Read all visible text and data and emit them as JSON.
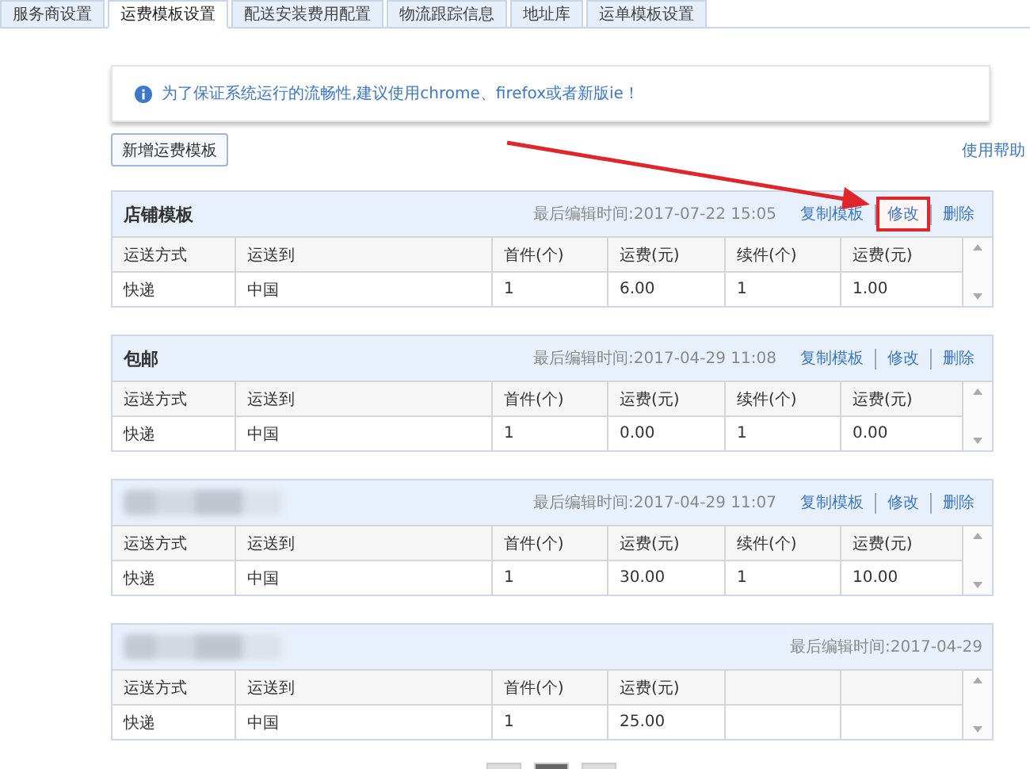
{
  "tabs": [
    {
      "label": "服务商设置",
      "selected": false
    },
    {
      "label": "运费模板设置",
      "selected": true
    },
    {
      "label": "配送安装费用配置",
      "selected": false
    },
    {
      "label": "物流跟踪信息",
      "selected": false
    },
    {
      "label": "地址库",
      "selected": false
    },
    {
      "label": "运单模板设置",
      "selected": false
    }
  ],
  "notice": {
    "text": "为了保证系统运行的流畅性,建议使用chrome、firefox或者新版ie！"
  },
  "add_button": "新增运费模板",
  "help_link": "使用帮助",
  "templates": [
    {
      "title": "店铺模板",
      "title_redacted": false,
      "edited": "最后编辑时间:2017-07-22 15:05",
      "actions": [
        {
          "label": "复制模板",
          "highlighted": false
        },
        {
          "label": "修改",
          "highlighted": true
        },
        {
          "label": "删除",
          "highlighted": false
        }
      ],
      "columns": [
        "运送方式",
        "运送到",
        "首件(个)",
        "运费(元)",
        "续件(个)",
        "运费(元)"
      ],
      "rows": [
        [
          "快递",
          "中国",
          "1",
          "6.00",
          "1",
          "1.00"
        ]
      ]
    },
    {
      "title": "包邮",
      "title_redacted": false,
      "edited": "最后编辑时间:2017-04-29 11:08",
      "actions": [
        {
          "label": "复制模板",
          "highlighted": false
        },
        {
          "label": "修改",
          "highlighted": false
        },
        {
          "label": "删除",
          "highlighted": false
        }
      ],
      "columns": [
        "运送方式",
        "运送到",
        "首件(个)",
        "运费(元)",
        "续件(个)",
        "运费(元)"
      ],
      "rows": [
        [
          "快递",
          "中国",
          "1",
          "0.00",
          "1",
          "0.00"
        ]
      ]
    },
    {
      "title_redacted": true,
      "edited": "最后编辑时间:2017-04-29 11:07",
      "actions": [
        {
          "label": "复制模板",
          "highlighted": false
        },
        {
          "label": "修改",
          "highlighted": false
        },
        {
          "label": "删除",
          "highlighted": false
        }
      ],
      "columns": [
        "运送方式",
        "运送到",
        "首件(个)",
        "运费(元)",
        "续件(个)",
        "运费(元)"
      ],
      "rows": [
        [
          "快递",
          "中国",
          "1",
          "30.00",
          "1",
          "10.00"
        ]
      ]
    },
    {
      "title_redacted": true,
      "edited": "最后编辑时间:2017-04-29",
      "columns": [
        "运送方式",
        "运送到",
        "首件(个)",
        "运费(元)"
      ],
      "rows": [
        [
          "快递",
          "中国",
          "1",
          "25.00"
        ]
      ]
    }
  ],
  "pagination": {
    "pages": [
      {
        "selected": false
      },
      {
        "selected": true
      },
      {
        "selected": false
      }
    ]
  }
}
